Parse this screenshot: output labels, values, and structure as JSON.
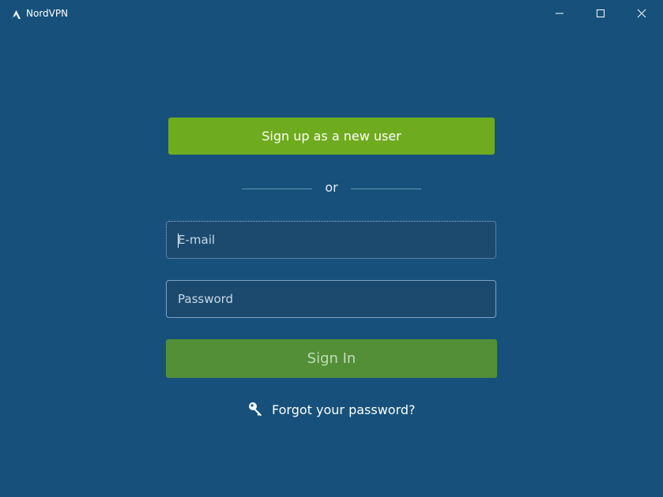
{
  "app": {
    "title": "NordVPN",
    "logo_icon": "nordvpn-mountain-icon"
  },
  "window_controls": {
    "minimize_icon": "minimize-icon",
    "maximize_icon": "maximize-icon",
    "close_icon": "close-icon"
  },
  "login": {
    "signup_label": "Sign up as a new user",
    "divider_text": "or",
    "email_placeholder": "E-mail",
    "email_value": "",
    "password_placeholder": "Password",
    "password_value": "",
    "signin_label": "Sign In",
    "forgot_label": "Forgot your password?",
    "forgot_icon": "key-icon"
  },
  "colors": {
    "background": "#17517b",
    "signup_button": "#6fab1e",
    "signin_button": "#528f36",
    "field_background": "#1b4a6e"
  }
}
